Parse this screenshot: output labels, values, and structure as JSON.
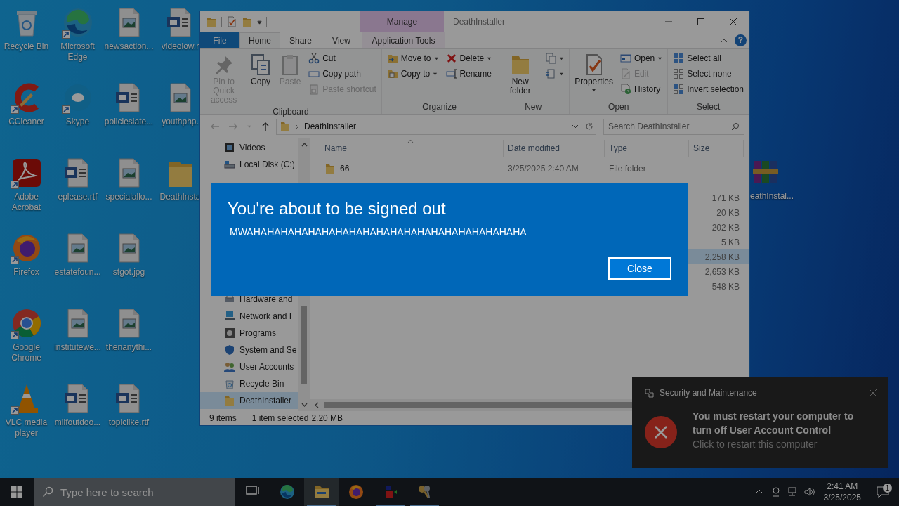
{
  "desktop": {
    "icons": [
      {
        "label": "Recycle Bin",
        "kind": "recycle",
        "shortcut": false
      },
      {
        "label": "CCleaner",
        "kind": "ccleaner",
        "shortcut": true
      },
      {
        "label": "Adobe Acrobat",
        "kind": "acrobat",
        "shortcut": true
      },
      {
        "label": "Firefox",
        "kind": "firefox",
        "shortcut": true
      },
      {
        "label": "Google Chrome",
        "kind": "chrome",
        "shortcut": true
      },
      {
        "label": "VLC media player",
        "kind": "vlc",
        "shortcut": true
      },
      {
        "label": "Microsoft Edge",
        "kind": "edge",
        "shortcut": true
      },
      {
        "label": "Skype",
        "kind": "skype",
        "shortcut": true
      },
      {
        "label": "eplease.rtf",
        "kind": "word",
        "shortcut": false
      },
      {
        "label": "estatefoun...",
        "kind": "image",
        "shortcut": false
      },
      {
        "label": "institutewe...",
        "kind": "image",
        "shortcut": false
      },
      {
        "label": "milfoutdoo...",
        "kind": "word",
        "shortcut": false
      },
      {
        "label": "newsaction...",
        "kind": "image",
        "shortcut": false
      },
      {
        "label": "policieslate...",
        "kind": "word",
        "shortcut": false
      },
      {
        "label": "specialallo...",
        "kind": "image",
        "shortcut": false
      },
      {
        "label": "stgot.jpg",
        "kind": "image",
        "shortcut": false
      },
      {
        "label": "thenanythi...",
        "kind": "image",
        "shortcut": false
      },
      {
        "label": "topiclike.rtf",
        "kind": "word",
        "shortcut": false
      },
      {
        "label": "videolow.r",
        "kind": "word",
        "shortcut": false
      },
      {
        "label": "youthphp.",
        "kind": "image",
        "shortcut": false
      },
      {
        "label": "DeathInsta",
        "kind": "folder",
        "shortcut": false
      }
    ],
    "side_icon": {
      "label": "eathInstal...",
      "kind": "archive",
      "shortcut": false
    }
  },
  "explorer": {
    "title": "DeathInstaller",
    "context_header": "Manage",
    "tabs": [
      {
        "label": "File",
        "kind": "file",
        "selected": false
      },
      {
        "label": "Home",
        "kind": "normal",
        "selected": true
      },
      {
        "label": "Share",
        "kind": "normal",
        "selected": false
      },
      {
        "label": "View",
        "kind": "normal",
        "selected": false
      },
      {
        "label": "Application Tools",
        "kind": "context",
        "selected": false
      }
    ],
    "help": "?",
    "ribbon": {
      "groups": [
        {
          "label": "Clipboard",
          "columns": [
            [
              {
                "label": "Pin to Quick access",
                "kind": "pin",
                "disabled": true,
                "dropdown": false
              }
            ],
            [
              {
                "label": "Copy",
                "kind": "copy",
                "disabled": false,
                "dropdown": false
              }
            ],
            [
              {
                "label": "Paste",
                "kind": "paste",
                "disabled": true,
                "dropdown": false
              }
            ],
            [
              {
                "label": "Cut",
                "kind": "cut",
                "disabled": false,
                "dropdown": false
              },
              {
                "label": "Copy path",
                "kind": "copypath",
                "disabled": false,
                "dropdown": false
              },
              {
                "label": "Paste shortcut",
                "kind": "pasteshortcut",
                "disabled": true,
                "dropdown": false
              }
            ]
          ]
        },
        {
          "label": "Organize",
          "columns": [
            [
              {
                "label": "Move to",
                "kind": "moveto",
                "disabled": false,
                "dropdown": true
              },
              {
                "label": "Copy to",
                "kind": "copyto",
                "disabled": false,
                "dropdown": true
              }
            ],
            [
              {
                "label": "Delete",
                "kind": "delete",
                "disabled": false,
                "dropdown": true
              },
              {
                "label": "Rename",
                "kind": "rename",
                "disabled": false,
                "dropdown": false
              }
            ]
          ]
        },
        {
          "label": "New",
          "columns": [
            [
              {
                "label": "New folder",
                "kind": "newfolder",
                "disabled": false,
                "dropdown": false
              }
            ],
            [
              {
                "kind": "newitem",
                "disabled": false,
                "dropdown": true
              },
              {
                "kind": "easyaccess",
                "disabled": false,
                "dropdown": true
              }
            ]
          ]
        },
        {
          "label": "Open",
          "columns": [
            [
              {
                "label": "Properties",
                "kind": "properties",
                "disabled": false,
                "dropdown": true
              }
            ],
            [
              {
                "label": "Open",
                "kind": "open",
                "disabled": false,
                "dropdown": true
              },
              {
                "label": "Edit",
                "kind": "edit",
                "disabled": true,
                "dropdown": false
              },
              {
                "label": "History",
                "kind": "history",
                "disabled": false,
                "dropdown": false
              }
            ]
          ]
        },
        {
          "label": "Select",
          "columns": [
            [
              {
                "label": "Select all",
                "kind": "selectall",
                "disabled": false,
                "dropdown": false
              },
              {
                "label": "Select none",
                "kind": "selectnone",
                "disabled": false,
                "dropdown": false
              },
              {
                "label": "Invert selection",
                "kind": "invert",
                "disabled": false,
                "dropdown": false
              }
            ]
          ]
        }
      ]
    },
    "address": "DeathInstaller",
    "search": {
      "placeholder": "Search DeathInstaller"
    },
    "nav_pane": {
      "sections": [
        {
          "items": [
            {
              "label": "Videos",
              "kind": "video",
              "selected": false
            },
            {
              "label": "Local Disk (C:)",
              "kind": "drive",
              "selected": false
            }
          ]
        },
        {
          "items": [
            {
              "label": "Hardware and",
              "kind": "hardware",
              "selected": false
            },
            {
              "label": "Network and I",
              "kind": "network",
              "selected": false
            },
            {
              "label": "Programs",
              "kind": "programs",
              "selected": false
            },
            {
              "label": "System and Se",
              "kind": "system",
              "selected": false
            },
            {
              "label": "User Accounts",
              "kind": "users",
              "selected": false
            },
            {
              "label": "Recycle Bin",
              "kind": "recycle",
              "selected": false
            },
            {
              "label": "DeathInstaller",
              "kind": "folder",
              "selected": true
            }
          ]
        }
      ]
    },
    "columns": [
      "Name",
      "Date modified",
      "Type",
      "Size"
    ],
    "rows": [
      {
        "name": "66",
        "date": "3/25/2025 2:40 AM",
        "type": "File folder",
        "selected": false
      },
      {
        "selected": false
      },
      {
        "size": "171 KB",
        "selected": false
      },
      {
        "size": "20 KB",
        "selected": false
      },
      {
        "size": "202 KB",
        "selected": false
      },
      {
        "size": "5 KB",
        "selected": false
      },
      {
        "size": "2,258 KB",
        "selected": true
      },
      {
        "size": "2,653 KB",
        "selected": false
      },
      {
        "size": "548 KB",
        "selected": false
      }
    ],
    "status": {
      "count": "9 items",
      "selection": "1 item selected",
      "size": "2.20 MB"
    }
  },
  "dialog": {
    "title": "You're about to be signed out",
    "message": "MWAHAHAHAHAHAHAHAHAHAHAHAHAHAHAHAHAHAHAHAHA",
    "button": "Close"
  },
  "toast": {
    "app": "Security and Maintenance",
    "title": "You must restart your computer to turn off User Account Control",
    "body": "Click to restart this computer"
  },
  "taskbar": {
    "search_placeholder": "Type here to search",
    "apps": [
      {
        "kind": "taskview",
        "running": false,
        "active": false
      },
      {
        "kind": "edge",
        "running": false,
        "active": false
      },
      {
        "kind": "explorer",
        "running": true,
        "active": true
      },
      {
        "kind": "firefox",
        "running": false,
        "active": false
      },
      {
        "kind": "app",
        "running": true,
        "active": false
      },
      {
        "kind": "keys",
        "running": true,
        "active": false
      }
    ],
    "time": "2:41 AM",
    "date": "3/25/2025",
    "notifications": "1"
  }
}
